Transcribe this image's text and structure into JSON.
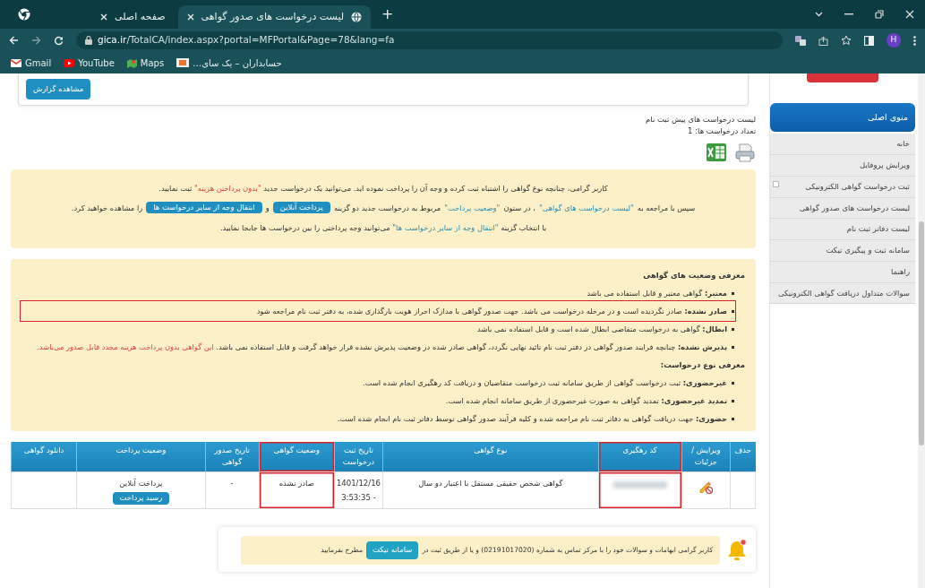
{
  "browser": {
    "tabs": [
      {
        "title": "لیست درخواست های صدور گواهی",
        "selected": true
      },
      {
        "title": "صفحه اصلی",
        "selected": false
      }
    ],
    "url": {
      "host": "gica.ir",
      "path": "/TotalCA/index.aspx?portal=MFPortal&Page=78&lang=fa"
    },
    "profile_initial": "H",
    "new_tab": "+",
    "bookmarks": [
      {
        "label": "حسابداران – یک سای…",
        "kind": "site"
      },
      {
        "label": "Maps",
        "kind": "map"
      },
      {
        "label": "YouTube",
        "kind": "video"
      },
      {
        "label": "Gmail",
        "kind": "mail"
      }
    ]
  },
  "report_button": "مشاهده گزارش",
  "list_title": "لیست درخواست های پیش ثبت نام",
  "request_count": "تعداد درخواست ها: 1",
  "notice": [
    [
      {
        "kind": "text",
        "text": "کاربر گرامی، چنانچه نوع گواهی را اشتباه ثبت کرده و وجه آن را پرداخت نموده اید. می‌توانید یک درخواست جدید "
      },
      {
        "kind": "red",
        "text": "\"بدون پرداختن هزینه\""
      },
      {
        "kind": "text",
        "text": " ثبت نمایید."
      }
    ],
    [
      {
        "kind": "text",
        "text": "سپس با مراجعه به "
      },
      {
        "kind": "teal",
        "text": "\"لیست درخواست های گواهی\""
      },
      {
        "kind": "text",
        "text": " ، در ستون "
      },
      {
        "kind": "teal",
        "text": "\"وضعیت پرداخت\""
      },
      {
        "kind": "text",
        "text": " مربوط به درخواست جدید دو گزینه"
      },
      {
        "kind": "button",
        "text": "پرداخت آنلاین"
      },
      {
        "kind": "text",
        "text": "و"
      },
      {
        "kind": "button",
        "text": "انتقال وجه از سایر درخواست ها"
      },
      {
        "kind": "text",
        "text": "را مشاهده خواهید کرد."
      }
    ],
    [
      {
        "kind": "text",
        "text": "با انتخاب گزینه "
      },
      {
        "kind": "teal",
        "text": "\"انتقال وجه از سایر درخواست ها\""
      },
      {
        "kind": "text",
        "text": " می‌توانید وجه پرداختی را بین درخواست ها جابجا نمایید."
      }
    ]
  ],
  "legend": {
    "status_title": "معرفی وضعیت های گواهی",
    "status_items": [
      {
        "text": "**معتبر:** گواهی معتبر و قابل استفاده می باشد",
        "highlighted": false
      },
      {
        "text": "**صادر نشده:** صادر نگردیده است و در مرحله درخواست می باشد. جهت صدور گواهی با مدارک احراز هویت بارگذاری شده، به دفتر ثبت نام مراجعه شود",
        "highlighted": true
      },
      {
        "text": "**ابطال:** گواهی به درخواست متقاضی ابطال شده است و قابل استفاده نمی باشد",
        "highlighted": false
      },
      {
        "text": "**پذیرش نشده:** چنانچه فرایند صدور گواهی در دفتر ثبت نام تائید نهایی نگردد، گواهی صادر شده در وضعیت پذیرش نشده قرار خواهد گرفت و قابل استفاده نمی باشد.",
        "warning": "این گواهی بدون پرداخت هزینه مجدد قابل صدور می‌باشد.",
        "highlighted": false
      }
    ],
    "type_title": "معرفی نوع درخواست:",
    "type_items": [
      "**غیرحضوری:** ثبت درخواست گواهی از طریق سامانه ثبت درخواست متقاضیان و دریافت کد رهگیری انجام شده است.",
      "**تمدید غیرحضوری:** تمدید گواهی به صورت غیرحضوری از طریق سامانه انجام شده است.",
      "**حضوری:** جهت دریافت گواهی به دفاتر ثبت نام مراجعه شده و کلیه فرآیند صدور گواهی توسط دفاتر ثبت نام انجام شده است."
    ]
  },
  "table": {
    "columns": [
      {
        "label": "حذف",
        "highlighted": false
      },
      {
        "label": "ویرایش / جزئیات",
        "highlighted": false
      },
      {
        "label": "کد رهگیری",
        "highlighted": true
      },
      {
        "label": "نوع گواهی",
        "highlighted": false
      },
      {
        "label": "تاریخ ثبت درخواست",
        "highlighted": false
      },
      {
        "label": "وضعیت گواهی",
        "highlighted": true
      },
      {
        "label": "تاریخ صدور گواهی",
        "highlighted": false
      },
      {
        "label": "وضعیت پرداخت",
        "highlighted": false
      },
      {
        "label": "دانلود گواهی",
        "highlighted": false
      }
    ],
    "rows": [
      [
        {
          "kind": "empty"
        },
        {
          "kind": "edit"
        },
        {
          "kind": "redacted"
        },
        {
          "kind": "text",
          "text": "گواهی شخص حقیقی مستقل با اعتبار دو سال"
        },
        {
          "kind": "datetime",
          "date": "1401/12/16",
          "time": "3:53:35 -"
        },
        {
          "kind": "text",
          "text": "صادر نشده"
        },
        {
          "kind": "text",
          "text": "-"
        },
        {
          "kind": "payment",
          "text": "پرداخت آنلاین",
          "button": "رسید پرداخت"
        },
        {
          "kind": "empty"
        }
      ]
    ]
  },
  "sidebar": {
    "title": "منوی اصلی",
    "items": [
      {
        "label": "خانه",
        "expandable": false
      },
      {
        "label": "ویرایش پروفایل",
        "expandable": false
      },
      {
        "label": "ثبت درخواست گواهی الکترونیکی",
        "expandable": true
      },
      {
        "label": "لیست درخواست های صدور گواهی",
        "expandable": false
      },
      {
        "label": "لیست دفاتر ثبت نام",
        "expandable": false
      },
      {
        "label": "سامانه ثبت و پیگیری تیکت",
        "expandable": false
      },
      {
        "label": "راهنما",
        "expandable": false
      },
      {
        "label": "سوالات متداول دریافت گواهی الکترونیکی",
        "expandable": false
      }
    ]
  },
  "footer_notice": {
    "before": "کاربر گرامی ابهامات و سوالات خود را با مرکز تماس به شماره (02191017020) و یا از طریق ثبت در",
    "button": "سامانه تیکت",
    "after": "مطرح بفرمایید"
  }
}
